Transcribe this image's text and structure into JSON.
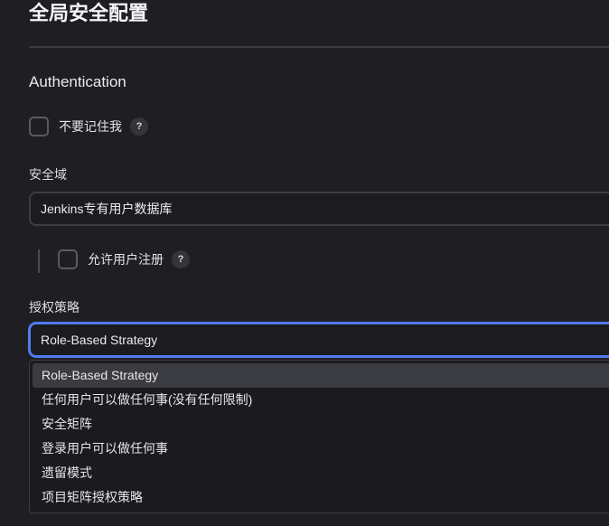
{
  "page_title": "全局安全配置",
  "authentication": {
    "heading": "Authentication",
    "remember_me_label": "不要记住我",
    "help_glyph": "?"
  },
  "security_realm": {
    "label": "安全域",
    "selected_value": "Jenkins专有用户数据库",
    "allow_signup_label": "允许用户注册",
    "help_glyph": "?"
  },
  "authorization": {
    "label": "授权策略",
    "selected_value": "Role-Based Strategy",
    "options": [
      "Role-Based Strategy",
      "任何用户可以做任何事(没有任何限制)",
      "安全矩阵",
      "登录用户可以做任何事",
      "遗留模式",
      "项目矩阵授权策略"
    ],
    "highlighted_option_index": 0
  },
  "colors": {
    "background": "#1f1f23",
    "focus_border": "#4f7cf0",
    "highlight": "#3b3b42"
  },
  "icons": {
    "help": "help-icon",
    "checkbox": "checkbox-unchecked"
  }
}
